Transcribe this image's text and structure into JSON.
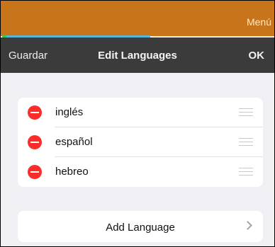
{
  "top_bar": {
    "menu_label": "Menú",
    "accent_color": "#c8741a"
  },
  "nav": {
    "left_label": "Guardar",
    "title": "Edit Languages",
    "right_label": "OK"
  },
  "languages": [
    {
      "label": "inglés"
    },
    {
      "label": "español"
    },
    {
      "label": "hebreo"
    }
  ],
  "add_language": {
    "label": "Add Language"
  },
  "colors": {
    "delete": "#fb2c29",
    "nav_background": "#3b3b3b",
    "page_background": "#efeff4"
  },
  "icons": {
    "delete": "minus-circle-icon",
    "reorder": "drag-handle-icon",
    "disclosure": "chevron-right-icon"
  }
}
